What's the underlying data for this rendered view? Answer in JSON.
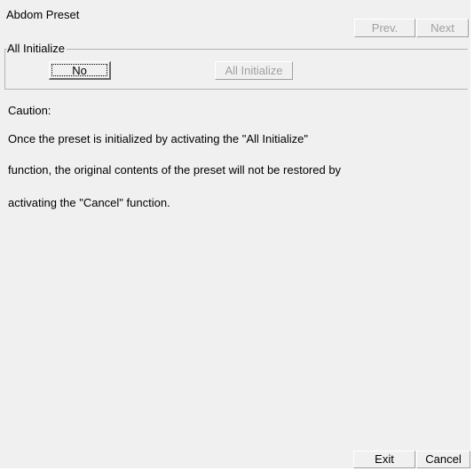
{
  "window": {
    "title": "Abdom Preset"
  },
  "nav": {
    "prev_label": "Prev.",
    "next_label": "Next"
  },
  "group": {
    "legend": "All Initialize",
    "no_label": "No",
    "all_initialize_label": "All Initialize"
  },
  "caution": {
    "heading": "Caution:",
    "lines": [
      "Once the preset is initialized by activating the \"All Initialize\"",
      "function, the original contents of the preset will not be restored by",
      "activating the \"Cancel\" function."
    ]
  },
  "footer": {
    "exit_label": "Exit",
    "cancel_label": "Cancel"
  },
  "colors": {
    "window_bg": "#f0f0f0",
    "disabled_text": "#a0a0a0",
    "text": "#000000"
  }
}
